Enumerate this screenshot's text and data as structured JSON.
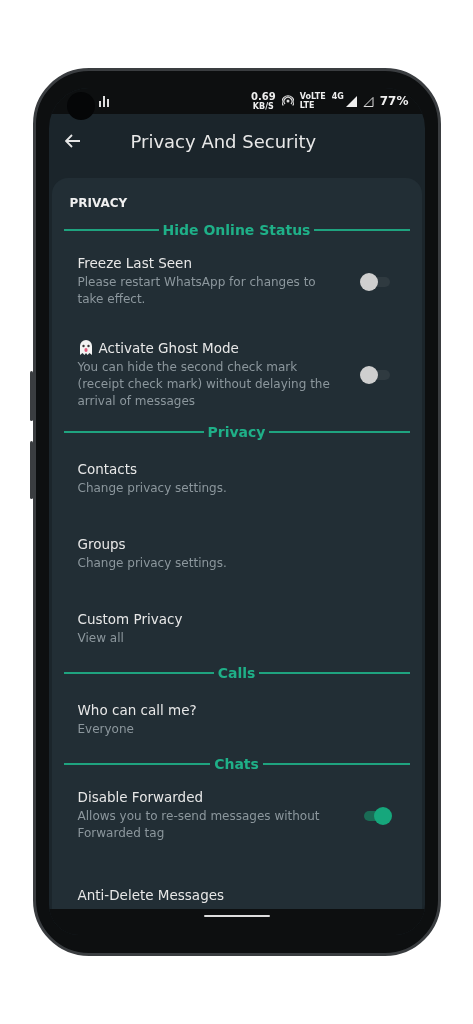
{
  "status_bar": {
    "speed": "0.69",
    "speed_unit": "KB/S",
    "network": "VoLTE",
    "network_sub": "LTE",
    "generation": "4G",
    "battery": "77%"
  },
  "app_bar": {
    "title": "Privacy And Security"
  },
  "card": {
    "heading": "PRIVACY",
    "sections": [
      {
        "title": "Hide Online Status",
        "items": [
          {
            "kind": "toggle",
            "title": "Freeze Last Seen",
            "subtitle": "Please restart WhatsApp for changes to take effect.",
            "checked": false
          },
          {
            "kind": "ghost_toggle",
            "title": "Activate Ghost Mode",
            "subtitle": "You can hide the second check mark (receipt check mark) without delaying the arrival of messages",
            "checked": false
          }
        ]
      },
      {
        "title": "Privacy",
        "items": [
          {
            "kind": "link",
            "title": "Contacts",
            "subtitle": "Change privacy settings."
          },
          {
            "kind": "link",
            "title": "Groups",
            "subtitle": "Change privacy settings."
          },
          {
            "kind": "link",
            "title": "Custom Privacy",
            "subtitle": "View all"
          }
        ]
      },
      {
        "title": "Calls",
        "items": [
          {
            "kind": "link",
            "title": "Who can call me?",
            "subtitle": "Everyone"
          }
        ]
      },
      {
        "title": "Chats",
        "items": [
          {
            "kind": "toggle",
            "title": "Disable Forwarded",
            "subtitle": "Allows you to re-send messages without Forwarded tag",
            "checked": true
          },
          {
            "kind": "link",
            "title": "Anti-Delete Messages"
          }
        ]
      }
    ]
  }
}
